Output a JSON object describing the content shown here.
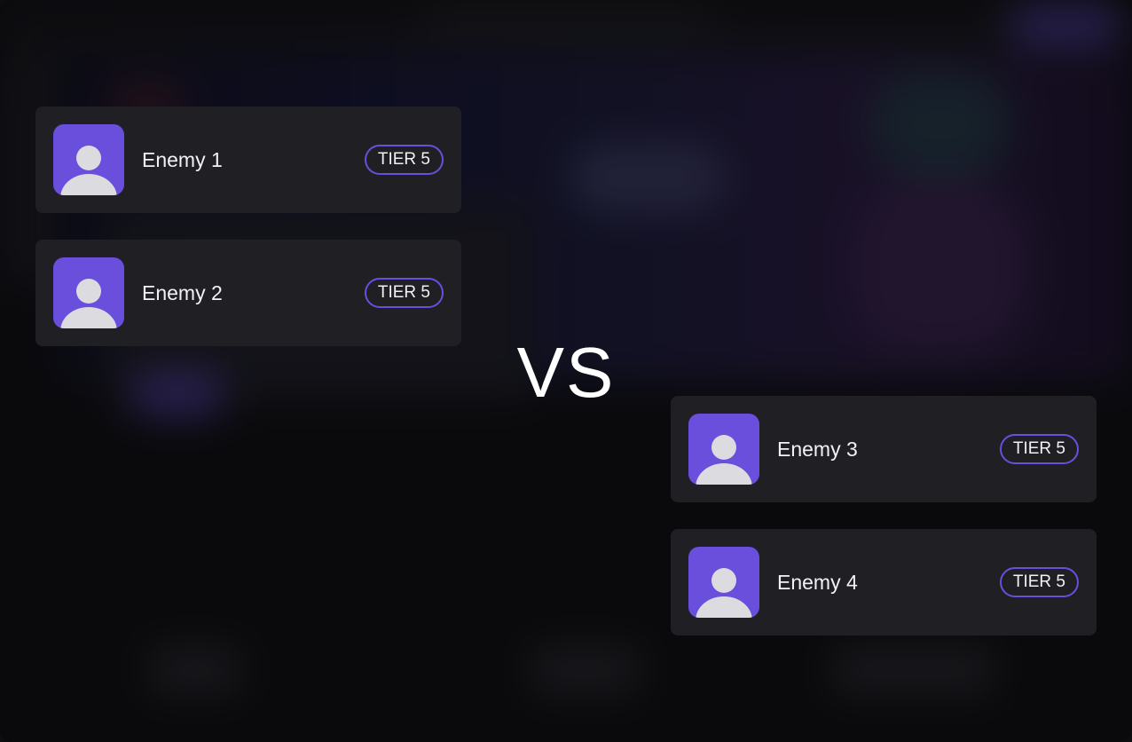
{
  "versus_label": "VS",
  "colors": {
    "accent": "#6a4fdc",
    "card_background": "#1f1f24",
    "text": "#f2f2f4"
  },
  "team_left": [
    {
      "name": "Enemy 1",
      "tier": "TIER 5",
      "avatar_icon": "user-icon"
    },
    {
      "name": "Enemy 2",
      "tier": "TIER 5",
      "avatar_icon": "user-icon"
    }
  ],
  "team_right": [
    {
      "name": "Enemy 3",
      "tier": "TIER 5",
      "avatar_icon": "user-icon"
    },
    {
      "name": "Enemy 4",
      "tier": "TIER 5",
      "avatar_icon": "user-icon"
    }
  ]
}
